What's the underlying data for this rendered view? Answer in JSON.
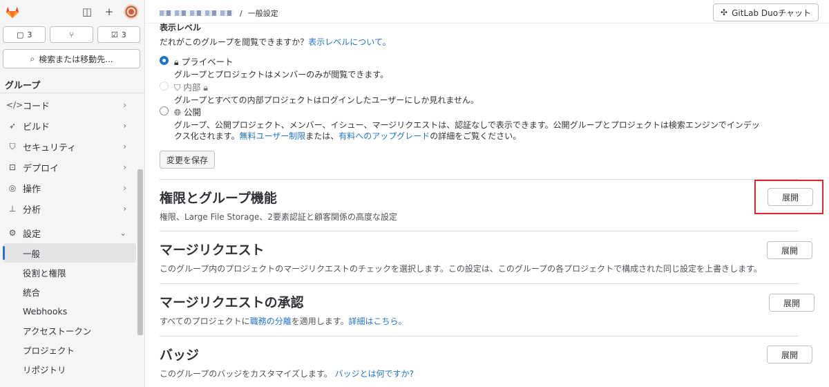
{
  "sidebar": {
    "counters": [
      {
        "icon": "issue-icon",
        "count": "3"
      },
      {
        "icon": "merge-request-icon",
        "count": ""
      },
      {
        "icon": "todo-icon",
        "count": "3"
      }
    ],
    "search_label": "検索または移動先...",
    "group_label": "グループ",
    "nav": [
      {
        "icon": "code-icon",
        "label": "コード"
      },
      {
        "icon": "rocket-icon",
        "label": "ビルド"
      },
      {
        "icon": "shield-icon",
        "label": "セキュリティ"
      },
      {
        "icon": "deploy-icon",
        "label": "デプロイ"
      },
      {
        "icon": "monitor-icon",
        "label": "操作"
      },
      {
        "icon": "chart-icon",
        "label": "分析"
      },
      {
        "icon": "gear-icon",
        "label": "設定"
      }
    ],
    "settings_sub": [
      "一般",
      "役割と権限",
      "統合",
      "Webhooks",
      "アクセストークン",
      "プロジェクト",
      "リポジトリ"
    ]
  },
  "header": {
    "breadcrumb_current": "一般設定",
    "duo_label": "GitLab Duoチャット"
  },
  "visibility": {
    "title": "表示レベル",
    "question": "だれがこのグループを閲覧できますか？",
    "question_link": "表示レベルについて。",
    "options": [
      {
        "label": "プライベート",
        "desc": "グループとプロジェクトはメンバーのみが閲覧できます。"
      },
      {
        "label": "内部",
        "desc": "グループとすべての内部プロジェクトはログインしたユーザーにしか見れません。"
      },
      {
        "label": "公開",
        "desc1": "グループ、公開プロジェクト、メンバー、イシュー、マージリクエストは、認証なしで表示できます。公開グループとプロジェクトは検索エンジンでインデッ",
        "desc2_a": "クス化されます。",
        "desc2_link1": "無料ユーザー制限",
        "desc2_b": "または、",
        "desc2_link2": "有料へのアップグレード",
        "desc2_c": "の詳細をご覧ください。"
      }
    ],
    "save_label": "変更を保存"
  },
  "sections": [
    {
      "title": "権限とグループ機能",
      "desc": "権限、Large File Storage、2要素認証と顧客関係の高度な設定",
      "button": "展開"
    },
    {
      "title": "マージリクエスト",
      "desc": "このグループ内のプロジェクトのマージリクエストのチェックを選択します。この設定は、このグループの各プロジェクトで構成された同じ設定を上書きします。",
      "button": "展開"
    },
    {
      "title": "マージリクエストの承認",
      "desc_a": "すべてのプロジェクトに",
      "desc_link": "職務の分離",
      "desc_b": "を適用します。",
      "desc_link2": "詳細はこちら。",
      "button": "展開"
    },
    {
      "title": "バッジ",
      "desc": "このグループのバッジをカスタマイズします。",
      "desc_link": "バッジとは何ですか?",
      "button": "展開"
    }
  ],
  "colors": {
    "accent": "#1f75cb",
    "highlight": "#e0262b"
  }
}
